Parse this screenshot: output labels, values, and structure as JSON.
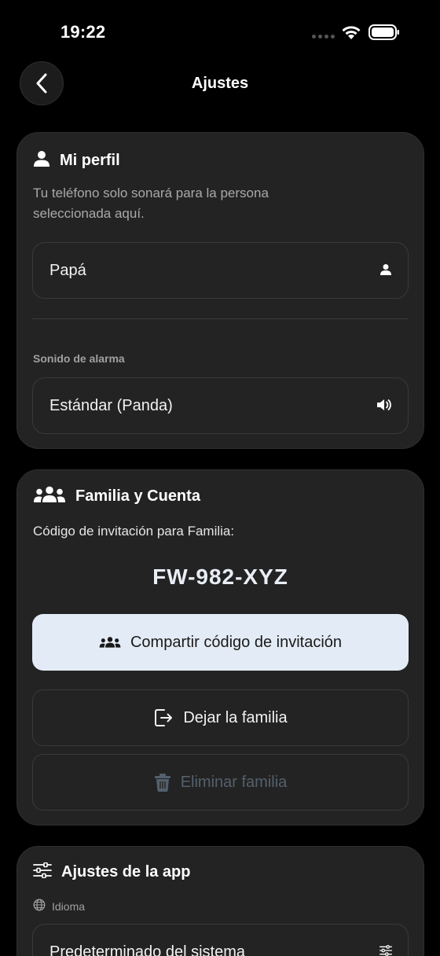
{
  "status_bar": {
    "time": "19:22"
  },
  "nav": {
    "title": "Ajustes"
  },
  "profile": {
    "title": "Mi perfil",
    "description": "Tu teléfono solo sonará para la persona seleccionada aquí.",
    "selected_person": "Papá",
    "alarm_label": "Sonido de alarma",
    "alarm_value": "Estándar (Panda)"
  },
  "family": {
    "title": "Familia y Cuenta",
    "invite_label": "Código de invitación para Familia:",
    "invite_code": "FW-982-XYZ",
    "share_label": "Compartir código de invitación",
    "leave_label": "Dejar la familia",
    "delete_label": "Eliminar familia"
  },
  "app_settings": {
    "title": "Ajustes de la app",
    "language_label": "Idioma",
    "language_value": "Predeterminado del sistema"
  },
  "colors": {
    "background": "#000000",
    "card": "#232323",
    "share_button": "#e3ecf6",
    "disabled_text": "#54606d"
  }
}
